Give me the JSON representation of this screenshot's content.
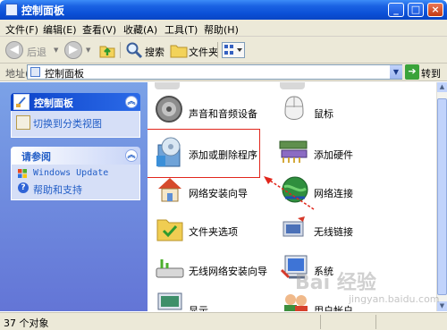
{
  "window": {
    "title": "控制面板",
    "controls": {
      "minimize": "_",
      "maximize": "□",
      "close": "×"
    }
  },
  "menu": [
    "文件(F)",
    "编辑(E)",
    "查看(V)",
    "收藏(A)",
    "工具(T)",
    "帮助(H)"
  ],
  "toolbar": {
    "back_label": "后退",
    "search_label": "搜索",
    "folders_label": "文件夹"
  },
  "address": {
    "label": "地址(D)",
    "value": "控制面板",
    "go_label": "转到"
  },
  "taskpane": {
    "control_panel_title": "控制面板",
    "switch_view": "切换到分类视图",
    "see_also_title": "请参阅",
    "links": [
      "Windows Update",
      "帮助和支持"
    ]
  },
  "items": [
    {
      "label": "声音和音频设备",
      "icon": "speaker-icon"
    },
    {
      "label": "鼠标",
      "icon": "mouse-icon"
    },
    {
      "label": "添加或删除程序",
      "icon": "add-remove-programs-icon"
    },
    {
      "label": "添加硬件",
      "icon": "add-hardware-icon"
    },
    {
      "label": "网络安装向导",
      "icon": "home-network-icon"
    },
    {
      "label": "网络连接",
      "icon": "network-globe-icon"
    },
    {
      "label": "文件夹选项",
      "icon": "folder-options-icon"
    },
    {
      "label": "无线链接",
      "icon": "wireless-link-icon"
    },
    {
      "label": "无线网络安装向导",
      "icon": "wireless-network-icon"
    },
    {
      "label": "系统",
      "icon": "system-icon"
    },
    {
      "label": "显示",
      "icon": "display-icon"
    },
    {
      "label": "用户帐户",
      "icon": "user-accounts-icon"
    }
  ],
  "status": {
    "count": "37 个对象"
  },
  "watermark": {
    "main": "Bai 经验",
    "sub": "jingyan.baidu.com"
  },
  "colors": {
    "titlebar": "#0a4fd6",
    "taskpane": "#6375d6",
    "link": "#215dc6",
    "highlight": "#e1261c"
  }
}
